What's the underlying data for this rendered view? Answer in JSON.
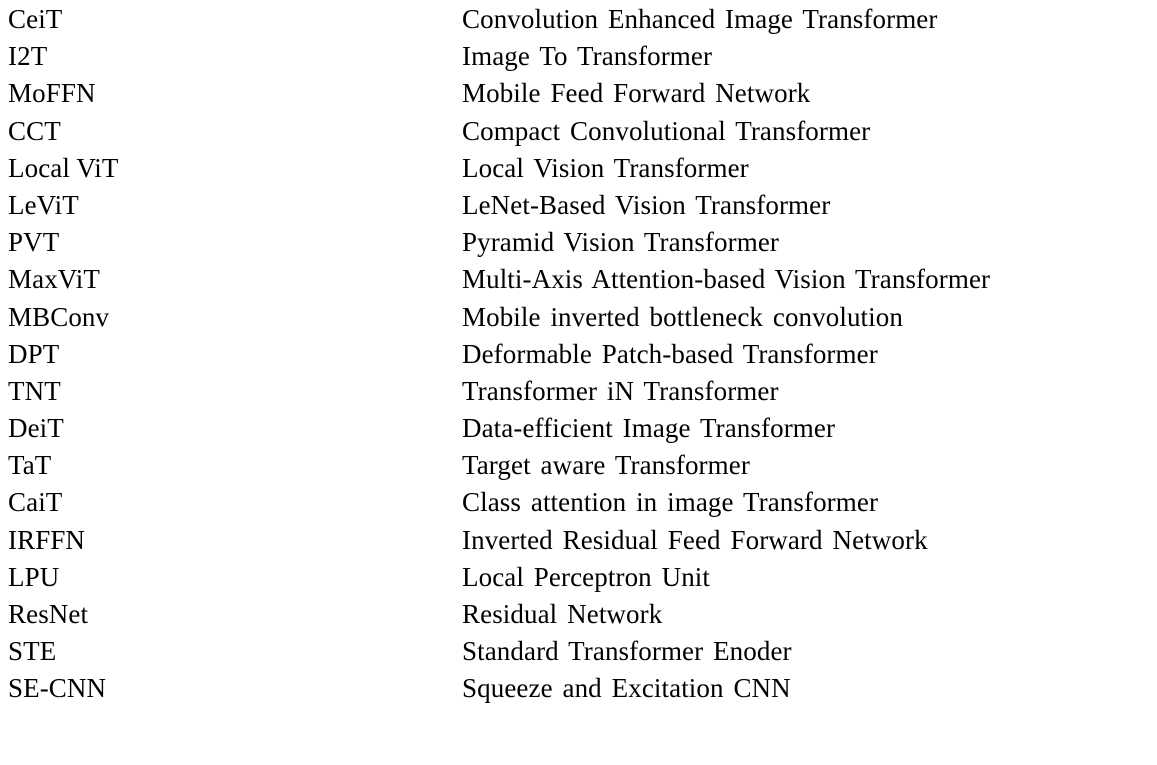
{
  "document": {
    "type": "abbreviations-glossary-table",
    "column_count": 2,
    "row_count": 20,
    "text_color": "#000000",
    "background_color": "#ffffff",
    "rows": [
      {
        "abbreviation": "CeiT",
        "full_form": "Convolution Enhanced Image Transformer"
      },
      {
        "abbreviation": "I2T",
        "full_form": "Image To Transformer"
      },
      {
        "abbreviation": "MoFFN",
        "full_form": "Mobile Feed Forward Network"
      },
      {
        "abbreviation": "CCT",
        "full_form": "Compact Convolutional Transformer"
      },
      {
        "abbreviation": "Local ViT",
        "full_form": "Local Vision Transformer"
      },
      {
        "abbreviation": "LeViT",
        "full_form": "LeNet-Based Vision Transformer"
      },
      {
        "abbreviation": "PVT",
        "full_form": "Pyramid Vision Transformer"
      },
      {
        "abbreviation": "MaxViT",
        "full_form": "Multi-Axis Attention-based Vision Transformer"
      },
      {
        "abbreviation": "MBConv",
        "full_form": "Mobile inverted bottleneck convolution"
      },
      {
        "abbreviation": "DPT",
        "full_form": "Deformable Patch-based Transformer"
      },
      {
        "abbreviation": "TNT",
        "full_form": "Transformer iN Transformer"
      },
      {
        "abbreviation": "DeiT",
        "full_form": "Data-efficient Image Transformer"
      },
      {
        "abbreviation": "TaT",
        "full_form": "Target aware Transformer"
      },
      {
        "abbreviation": "CaiT",
        "full_form": "Class attention in image Transformer"
      },
      {
        "abbreviation": "IRFFN",
        "full_form": "Inverted Residual Feed Forward Network"
      },
      {
        "abbreviation": "LPU",
        "full_form": "Local Perceptron Unit"
      },
      {
        "abbreviation": "ResNet",
        "full_form": "Residual Network"
      },
      {
        "abbreviation": "STE",
        "full_form": "Standard Transformer Enoder"
      },
      {
        "abbreviation": "SE-CNN",
        "full_form": "Squeeze and Excitation CNN"
      }
    ]
  }
}
